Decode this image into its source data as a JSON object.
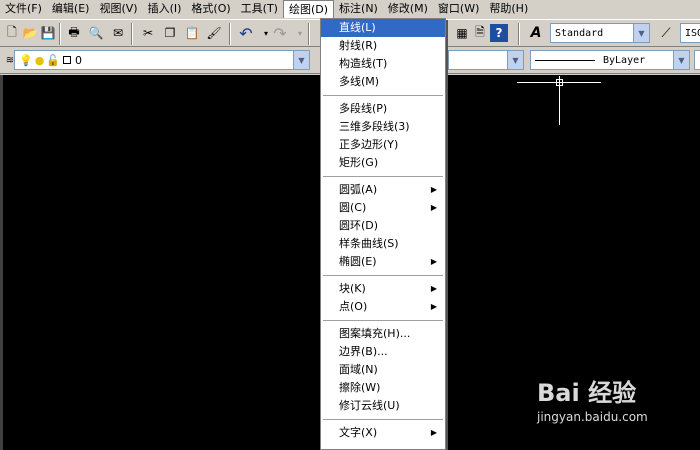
{
  "menubar": {
    "items": [
      "文件(F)",
      "编辑(E)",
      "视图(V)",
      "插入(I)",
      "格式(O)",
      "工具(T)",
      "绘图(D)",
      "标注(N)",
      "修改(M)",
      "窗口(W)",
      "帮助(H)"
    ],
    "active": 6
  },
  "toolbar": {
    "text_style": "Standard",
    "dim_style": "ISO",
    "layer": "0",
    "linetype": "ByLayer"
  },
  "draw_menu": {
    "items": [
      {
        "label": "直线(L)",
        "highlight": true
      },
      {
        "label": "射线(R)"
      },
      {
        "label": "构造线(T)"
      },
      {
        "label": "多线(M)"
      },
      {
        "sep": true
      },
      {
        "label": "多段线(P)"
      },
      {
        "label": "三维多段线(3)"
      },
      {
        "label": "正多边形(Y)"
      },
      {
        "label": "矩形(G)"
      },
      {
        "sep": true
      },
      {
        "label": "圆弧(A)",
        "submenu": true
      },
      {
        "label": "圆(C)",
        "submenu": true
      },
      {
        "label": "圆环(D)"
      },
      {
        "label": "样条曲线(S)"
      },
      {
        "label": "椭圆(E)",
        "submenu": true
      },
      {
        "sep": true
      },
      {
        "label": "块(K)",
        "submenu": true
      },
      {
        "label": "点(O)",
        "submenu": true
      },
      {
        "sep": true
      },
      {
        "label": "图案填充(H)..."
      },
      {
        "label": "边界(B)..."
      },
      {
        "label": "面域(N)"
      },
      {
        "label": "擦除(W)"
      },
      {
        "label": "修订云线(U)"
      },
      {
        "sep": true
      },
      {
        "label": "文字(X)",
        "submenu": true
      }
    ]
  },
  "watermark": {
    "logo": "Bai 经验",
    "url": "jingyan.baidu.com"
  }
}
